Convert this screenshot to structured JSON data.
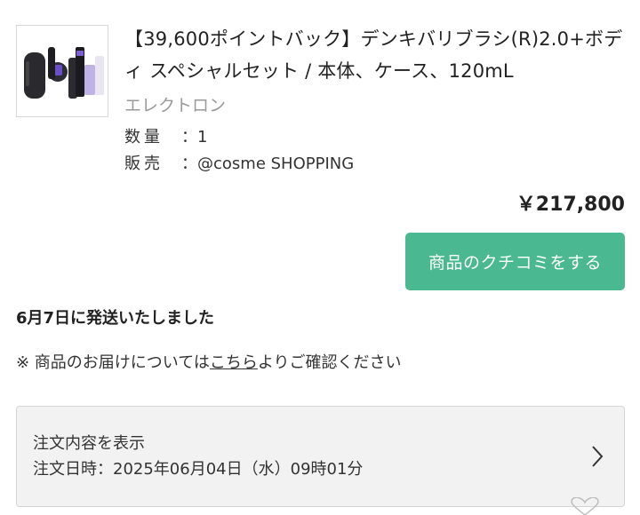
{
  "product": {
    "title": "【39,600ポイントバック】デンキバリブラシ(R)2.0+ボディ スペシャルセット / 本体、ケース、120mL",
    "brand": "エレクトロン",
    "qty_label": "数量",
    "qty_value": "：1",
    "shop_label": "販売",
    "shop_value": "：@cosme SHOPPING",
    "price": "￥217,800",
    "image_icon": "product-set-image"
  },
  "review_button": {
    "label": "商品のクチコミをする",
    "color": "#4ab890"
  },
  "shipping": {
    "status": "6月7日に発送いたしました",
    "note_prefix": "※ 商品のお届けについては",
    "note_link": "こちら",
    "note_suffix": "よりご確認ください"
  },
  "order": {
    "view_label": "注文内容を表示",
    "date_text": "注文日時：2025年06月04日（水）09時01分"
  },
  "icons": {
    "chevron": "chevron-right-icon",
    "heart": "heart-outline-icon"
  }
}
